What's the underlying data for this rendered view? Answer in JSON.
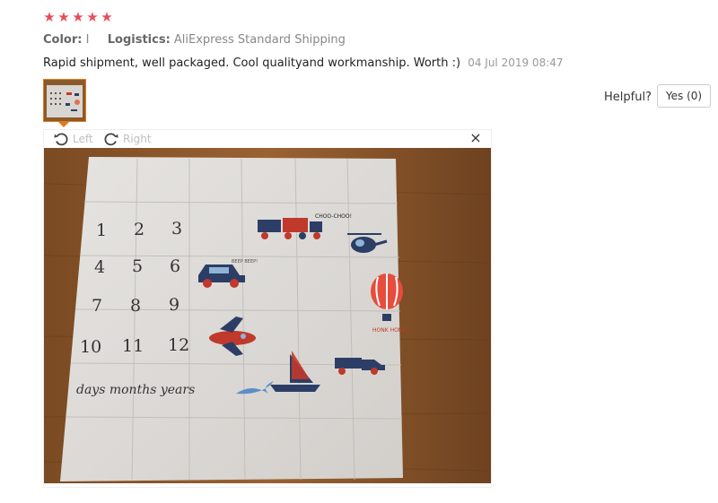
{
  "review": {
    "rating": 5,
    "star_glyph": "★",
    "color_label": "Color:",
    "color_value": "I",
    "logistics_label": "Logistics:",
    "logistics_value": "AliExpress Standard Shipping",
    "text": "Rapid shipment, well packaged. Cool qualityand workmanship. Worth :)",
    "date": "04 Jul 2019 08:47",
    "star_color": "#e74c5a"
  },
  "helpful": {
    "label": "Helpful?",
    "yes_button": "Yes (0)"
  },
  "viewer": {
    "rotate_left_label": "Left",
    "rotate_right_label": "Right",
    "close_glyph": "×",
    "rotate_left_icon": "rotate-left-icon",
    "rotate_right_icon": "rotate-right-icon",
    "close_icon": "close-icon"
  },
  "photo": {
    "numbers": [
      "1",
      "2",
      "3",
      "4",
      "5",
      "6",
      "7",
      "8",
      "9",
      "10",
      "11",
      "12"
    ],
    "handwriting": "days months years",
    "train_label": "CHOO-CHOO!",
    "car_label": "BEEP BEEP!",
    "balloon_label": "HONK HONK!",
    "accent_color": "#e07a1c"
  }
}
